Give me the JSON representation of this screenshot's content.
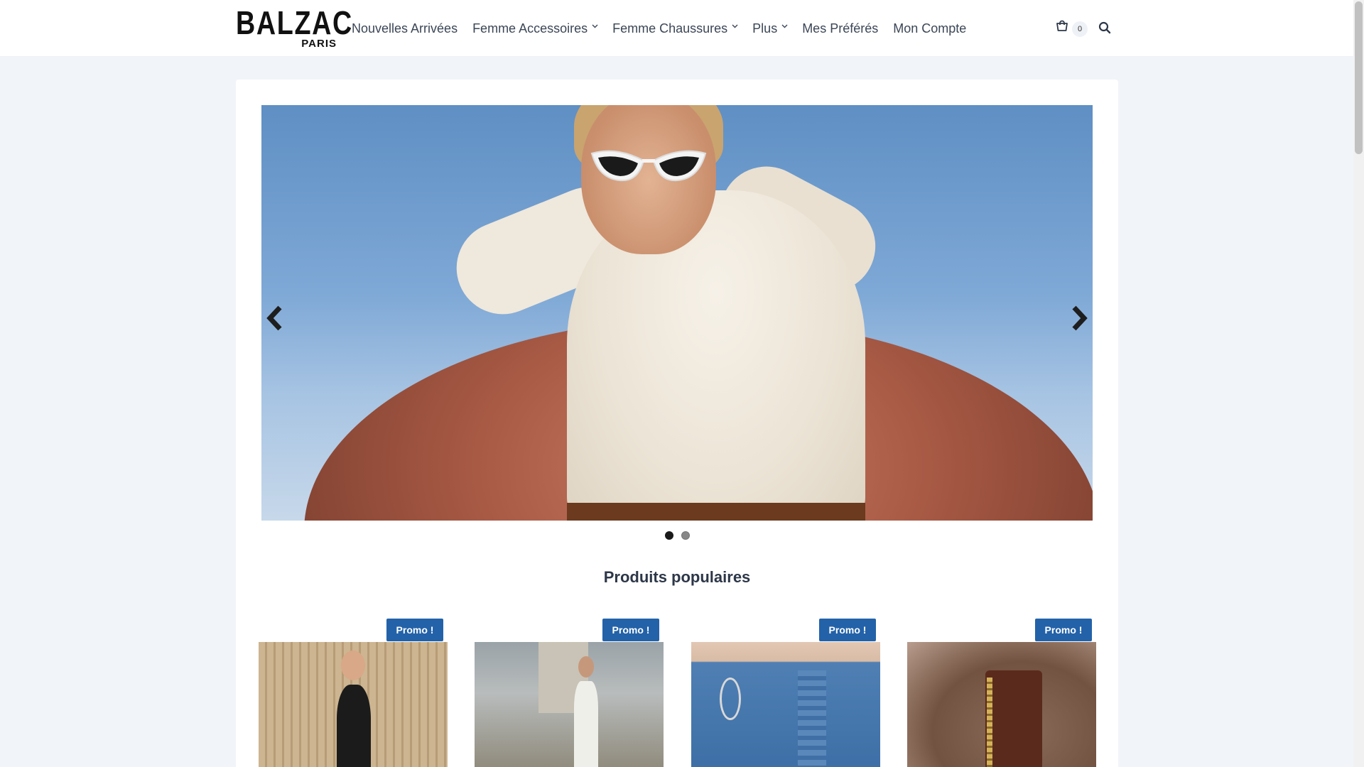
{
  "header": {
    "logo": {
      "main": "BALZAC",
      "sub": "PARIS"
    },
    "nav": [
      {
        "label": "Nouvelles Arrivées",
        "has_dropdown": false
      },
      {
        "label": "Femme Accessoires",
        "has_dropdown": true
      },
      {
        "label": "Femme Chaussures",
        "has_dropdown": true
      },
      {
        "label": "Plus",
        "has_dropdown": true
      },
      {
        "label": "Mes Préférés",
        "has_dropdown": false
      },
      {
        "label": "Mon Compte",
        "has_dropdown": false
      }
    ],
    "cart": {
      "icon": "cart-icon",
      "count": "0"
    },
    "search": {
      "icon": "search-icon"
    }
  },
  "slider": {
    "slides_total": 2,
    "active_slide": 1,
    "prev_icon": "chevron-left-icon",
    "next_icon": "chevron-right-icon"
  },
  "section": {
    "title": "Produits populaires"
  },
  "products": [
    {
      "badge": "Promo !"
    },
    {
      "badge": "Promo !"
    },
    {
      "badge": "Promo !"
    },
    {
      "badge": "Promo !"
    }
  ],
  "colors": {
    "accent": "#2362a8",
    "page_background": "#f1f4f8",
    "nav_text": "#3b4656"
  }
}
